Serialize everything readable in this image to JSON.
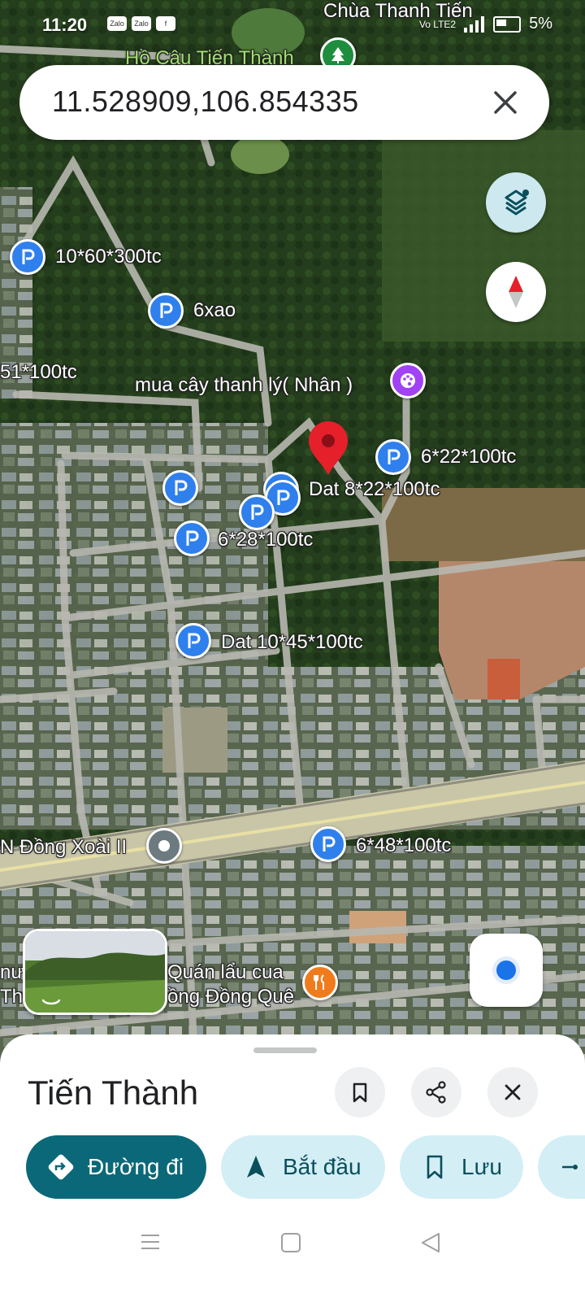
{
  "status_bar": {
    "time": "11:20",
    "apps": [
      "Zalo",
      "Zalo",
      "f"
    ],
    "network": "Vo LTE2",
    "battery": "5%"
  },
  "search": {
    "query": "11.528909,106.854335"
  },
  "map_labels": {
    "temple": "Chùa Thanh Tiến",
    "lake": "Hồ Câu Tiến Thành",
    "listing_1": "10*60*300tc",
    "listing_2": "6xao",
    "listing_3": "51*100tc",
    "shop": "mua cây thanh lý( Nhân )",
    "listing_4": "6*22*100tc",
    "listing_5": "Dat 8*22*100tc",
    "listing_6": "6*28*100tc",
    "listing_7": "Dat 10*45*100tc",
    "road": "N Đồng Xoài II",
    "listing_8": "6*48*100tc",
    "restaurant_line1": "Quán lẩu cua",
    "restaurant_line2": "ồng Đồng Quê",
    "edge_text_1": "nư",
    "edge_text_2": "Th"
  },
  "place_sheet": {
    "title": "Tiến Thành",
    "actions": {
      "directions": "Đường đi",
      "start": "Bắt đầu",
      "save": "Lưu"
    }
  },
  "colors": {
    "accent": "#0b6879",
    "chip_bg": "#d3eef5",
    "pin_blue": "#2f80ed",
    "dropped_pin": "#e5202b"
  }
}
